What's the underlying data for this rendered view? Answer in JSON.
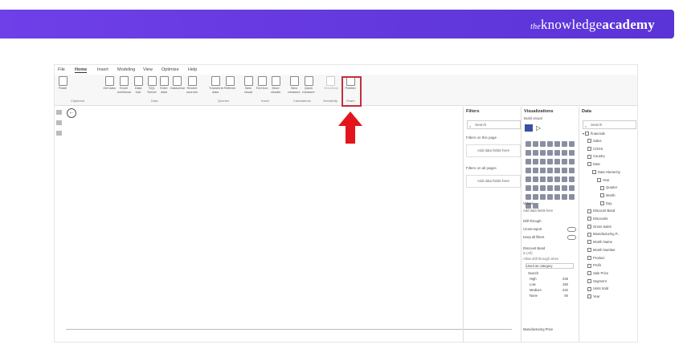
{
  "brand": {
    "prefix": "the",
    "word1": "knowledge",
    "word2": "academy"
  },
  "menu": [
    "File",
    "Home",
    "Insert",
    "Modeling",
    "View",
    "Optimize",
    "Help"
  ],
  "ribbon": {
    "buttons": [
      "Paste",
      "Get data",
      "Excel workbook",
      "Data hub",
      "SQL Server",
      "Enter data",
      "Dataverse",
      "Recent sources",
      "Transform data",
      "Refresh",
      "New visual",
      "Text box",
      "More visuals",
      "New measure",
      "Quick measure",
      "Sensitivity",
      "Publish"
    ],
    "groups": [
      "Clipboard",
      "Data",
      "Queries",
      "Insert",
      "Calculations",
      "Sensitivity",
      "Share"
    ]
  },
  "filters": {
    "title": "Filters",
    "search": "Search",
    "on_page": "Filters on this page",
    "on_all": "Filters on all pages",
    "add_here": "Add data fields here"
  },
  "visualizations": {
    "title": "Visualizations",
    "sub": "Build visual",
    "values_label": "Values",
    "values_add": "Add data fields here",
    "drill": "Drill through",
    "cross": "Cross-report",
    "keep": "Keep all filters",
    "off": "Off",
    "field_name": "Discount Band",
    "field_sub1": "is (All)",
    "field_sub2": "Allow drill through when",
    "dropdown": "Used as category",
    "search": "Search",
    "items": [
      [
        "High",
        "246"
      ],
      [
        "Low",
        "160"
      ],
      [
        "Medium",
        "242"
      ],
      [
        "None",
        "50"
      ]
    ],
    "bottom": "Manufacturing Price"
  },
  "data": {
    "title": "Data",
    "search": "Search",
    "table": "financials",
    "fields": [
      "Sales",
      "COGS",
      "Country",
      "Date",
      "Date Hierarchy",
      "Year",
      "Quarter",
      "Month",
      "Day",
      "Discount Band",
      "Discounts",
      "Gross Sales",
      "Manufacturing P...",
      "Month Name",
      "Month Number",
      "Product",
      "Profit",
      "Sale Price",
      "Segment",
      "Units Sold",
      "Year"
    ]
  }
}
